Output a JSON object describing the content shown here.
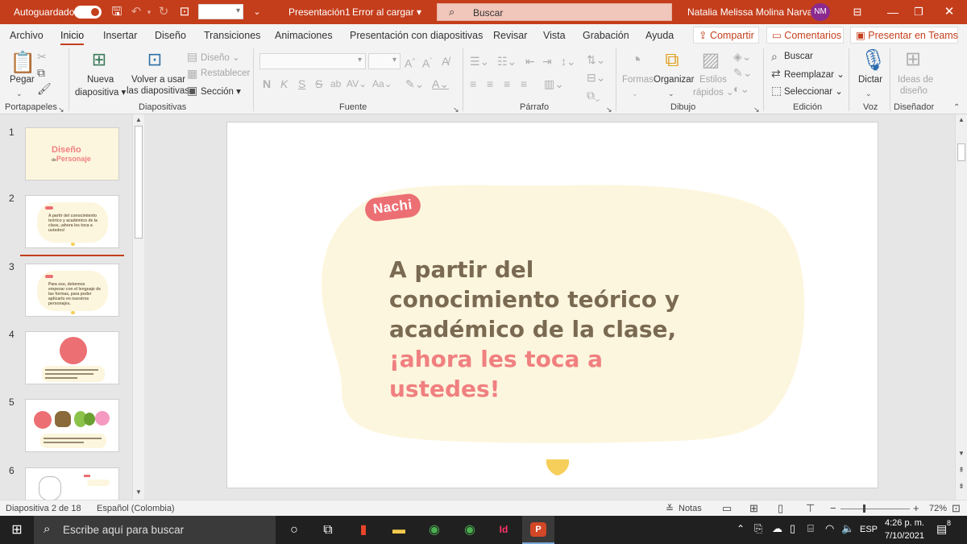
{
  "titlebar": {
    "autosave_label": "Autoguardado",
    "document_title": "Presentación1",
    "error_status": "Error al cargar",
    "search_label": "Buscar",
    "user_name": "Natalia Melissa Molina Narvaez",
    "user_initials": "NM"
  },
  "menu": {
    "tabs": [
      "Archivo",
      "Inicio",
      "Insertar",
      "Diseño",
      "Transiciones",
      "Animaciones",
      "Presentación con diapositivas",
      "Revisar",
      "Vista",
      "Grabación",
      "Ayuda"
    ],
    "share_label": "Compartir",
    "comments_label": "Comentarios",
    "teams_label": "Presentar en Teams"
  },
  "ribbon": {
    "paste_label": "Pegar",
    "clipboard_group": "Portapapeles",
    "new_slide_l1": "Nueva",
    "new_slide_l2": "diapositiva",
    "reuse_l1": "Volver a usar",
    "reuse_l2": "las diapositivas",
    "layout_label": "Diseño",
    "reset_label": "Restablecer",
    "section_label": "Sección",
    "slides_group": "Diapositivas",
    "font_group": "Fuente",
    "paragraph_group": "Párrafo",
    "shapes_label": "Formas",
    "arrange_label": "Organizar",
    "styles_l1": "Estilos",
    "styles_l2": "rápidos",
    "drawing_group": "Dibujo",
    "find_label": "Buscar",
    "replace_label": "Reemplazar",
    "select_label": "Seleccionar",
    "editing_group": "Edición",
    "dictate_label": "Dictar",
    "voice_group": "Voz",
    "ideas_l1": "Ideas de",
    "ideas_l2": "diseño",
    "designer_group": "Diseñador",
    "bold": "N",
    "italic": "K",
    "underline": "S",
    "strike": "S",
    "shadow": "ab"
  },
  "thumbnails": [
    {
      "num": "1",
      "title_a": "Diseño",
      "title_b": "de",
      "title_c": "Personaje"
    },
    {
      "num": "2",
      "text": "A partir del conocimiento teórico y académico de la clase, ¡ahora les toca a ustedes!"
    },
    {
      "num": "3",
      "text": "Para eso, debemos empezar con el lenguaje de las formas, para poder aplicarlo en nuestros personajes."
    },
    {
      "num": "4"
    },
    {
      "num": "5"
    },
    {
      "num": "6"
    }
  ],
  "slide": {
    "tag": "Nachi",
    "body_main": "A partir del conocimiento teórico y académico de la clase, ",
    "body_highlight": "¡ahora les toca a ustedes!",
    "colors": {
      "blob": "#fdf6de",
      "tag": "#eb6f73",
      "text": "#7a6a52",
      "highlight": "#f08080",
      "heart": "#f6cf5b"
    }
  },
  "status": {
    "slide_counter": "Diapositiva 2 de 18",
    "language": "Español (Colombia)",
    "notes_label": "Notas",
    "zoom": "72%"
  },
  "taskbar": {
    "search_placeholder": "Escribe aquí para buscar",
    "lang": "ESP",
    "time": "4:26 p. m.",
    "date": "7/10/2021",
    "notification_count": "8"
  }
}
